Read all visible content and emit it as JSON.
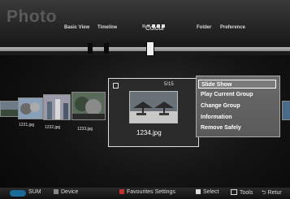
{
  "header": {
    "title": "Photo",
    "views": [
      "Basic View",
      "Timeline",
      "Colour",
      "Folder",
      "Preference"
    ],
    "active_view": "Colour"
  },
  "thumbnails": [
    {
      "name": "1231.jpg"
    },
    {
      "name": "1232.jpg"
    },
    {
      "name": "1233.jpg"
    }
  ],
  "selected_card": {
    "counter": "5/15",
    "filename": "1234.jpg"
  },
  "context_menu": {
    "items": [
      "Slide Show",
      "Play Current Group",
      "Change Group",
      "Information",
      "Remove Safely"
    ],
    "selected": "Slide Show"
  },
  "footer": {
    "sum": "SUM",
    "device": "Device",
    "favourites": "Favourites Settings",
    "select": "Select",
    "tools": "Tools",
    "return": "Retur"
  },
  "colors": {
    "footer_red": "#c23030",
    "footer_green": "#3a9a3a",
    "footer_yellow": "#c9b23a",
    "footer_blue": "#3a6ac9"
  }
}
